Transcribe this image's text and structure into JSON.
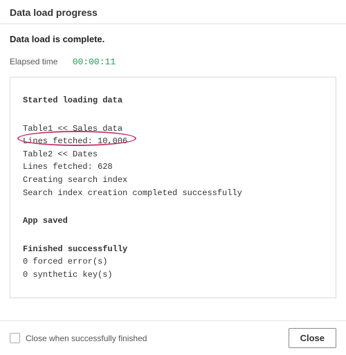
{
  "header": {
    "title": "Data load progress"
  },
  "status": "Data load is complete.",
  "elapsed": {
    "label": "Elapsed time",
    "value": "00:00:11"
  },
  "log": {
    "started": "Started loading data",
    "t1_load": "Table1 << Sales data",
    "t1_lines": "Lines fetched: 10,006",
    "t2_load": "Table2 << Dates",
    "t2_lines": "Lines fetched: 628",
    "idx1": "Creating search index",
    "idx2": "Search index creation completed successfully",
    "saved": "App saved",
    "finished": "Finished successfully",
    "forced": "0 forced error(s)",
    "synthetic": "0 synthetic key(s)"
  },
  "footer": {
    "checkbox_label": "Close when successfully finished",
    "close_label": "Close"
  },
  "annotation": {
    "color": "#c8326a"
  }
}
